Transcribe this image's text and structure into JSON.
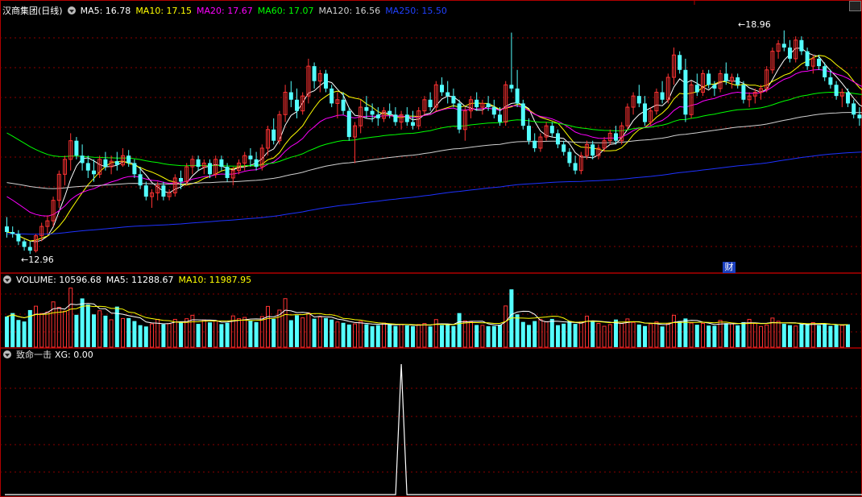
{
  "stock": {
    "name": "汉商集团(日线)"
  },
  "main_panel": {
    "ma": [
      {
        "label": "MA5: 16.78",
        "color": "#ffffff"
      },
      {
        "label": "MA10: 17.15",
        "color": "#ffff00"
      },
      {
        "label": "MA20: 17.67",
        "color": "#ff00ff"
      },
      {
        "label": "MA60: 17.07",
        "color": "#00ff00"
      },
      {
        "label": "MA120: 16.56",
        "color": "#d0d0d0"
      },
      {
        "label": "MA250: 15.50",
        "color": "#1e32ff"
      }
    ],
    "high_label": "18.96",
    "low_label": "12.96",
    "cai_badge": "财"
  },
  "volume_panel": {
    "labels": [
      {
        "label": "VOLUME: 10596.68",
        "color": "#ffffff"
      },
      {
        "label": "MA5: 11288.67",
        "color": "#ffffff"
      },
      {
        "label": "MA10: 11987.95",
        "color": "#ffff00"
      }
    ]
  },
  "indicator_panel": {
    "name": "致命一击",
    "xg_label": "XG: 0.00"
  },
  "colors": {
    "up": "#ff3232",
    "down": "#54ffff",
    "grid": "#8a0000",
    "border": "#b00000"
  },
  "chart_data": {
    "type": "candlestick",
    "price_range": [
      12.6,
      19.3
    ],
    "candles": [
      [
        13.7,
        13.95,
        13.4,
        13.55
      ],
      [
        13.55,
        13.7,
        13.4,
        13.5
      ],
      [
        13.5,
        13.6,
        13.2,
        13.3
      ],
      [
        13.3,
        13.35,
        13.05,
        13.15
      ],
      [
        13.15,
        13.3,
        12.96,
        13.05
      ],
      [
        13.05,
        13.5,
        13.0,
        13.45
      ],
      [
        13.45,
        13.8,
        13.3,
        13.7
      ],
      [
        13.7,
        14.0,
        13.5,
        13.85
      ],
      [
        13.85,
        14.5,
        13.7,
        14.4
      ],
      [
        14.4,
        15.2,
        14.2,
        15.1
      ],
      [
        15.1,
        15.6,
        14.8,
        15.5
      ],
      [
        15.5,
        16.2,
        15.2,
        16.0
      ],
      [
        16.0,
        16.1,
        15.5,
        15.6
      ],
      [
        15.6,
        15.9,
        15.2,
        15.4
      ],
      [
        15.4,
        15.6,
        15.0,
        15.2
      ],
      [
        15.2,
        15.5,
        14.9,
        15.1
      ],
      [
        15.1,
        15.6,
        15.0,
        15.5
      ],
      [
        15.5,
        15.7,
        15.2,
        15.3
      ],
      [
        15.3,
        15.6,
        15.1,
        15.45
      ],
      [
        15.45,
        15.7,
        15.2,
        15.35
      ],
      [
        15.35,
        15.8,
        15.3,
        15.6
      ],
      [
        15.6,
        15.75,
        15.3,
        15.4
      ],
      [
        15.4,
        15.5,
        15.0,
        15.1
      ],
      [
        15.1,
        15.3,
        14.7,
        14.8
      ],
      [
        14.8,
        14.9,
        14.4,
        14.5
      ],
      [
        14.5,
        14.7,
        14.2,
        14.6
      ],
      [
        14.6,
        14.9,
        14.4,
        14.8
      ],
      [
        14.8,
        14.9,
        14.4,
        14.5
      ],
      [
        14.5,
        14.7,
        14.4,
        14.6
      ],
      [
        14.6,
        15.1,
        14.5,
        15.0
      ],
      [
        15.0,
        15.2,
        14.7,
        14.9
      ],
      [
        14.9,
        15.4,
        14.8,
        15.3
      ],
      [
        15.3,
        15.6,
        15.1,
        15.5
      ],
      [
        15.5,
        15.6,
        15.2,
        15.3
      ],
      [
        15.3,
        15.5,
        15.1,
        15.4
      ],
      [
        15.4,
        15.5,
        15.0,
        15.1
      ],
      [
        15.1,
        15.6,
        15.0,
        15.5
      ],
      [
        15.5,
        15.6,
        15.2,
        15.3
      ],
      [
        15.3,
        15.4,
        14.9,
        15.0
      ],
      [
        15.0,
        15.3,
        14.8,
        15.2
      ],
      [
        15.2,
        15.5,
        15.1,
        15.4
      ],
      [
        15.4,
        15.7,
        15.2,
        15.6
      ],
      [
        15.6,
        15.8,
        15.3,
        15.5
      ],
      [
        15.5,
        15.7,
        15.2,
        15.3
      ],
      [
        15.3,
        15.9,
        15.2,
        15.8
      ],
      [
        15.8,
        16.4,
        15.6,
        16.3
      ],
      [
        16.3,
        16.6,
        15.9,
        16.0
      ],
      [
        16.0,
        16.8,
        15.9,
        16.7
      ],
      [
        16.7,
        17.5,
        16.5,
        17.3
      ],
      [
        17.3,
        17.6,
        16.9,
        17.1
      ],
      [
        17.1,
        17.4,
        16.6,
        16.8
      ],
      [
        16.8,
        17.3,
        16.7,
        17.2
      ],
      [
        17.2,
        18.2,
        17.0,
        18.0
      ],
      [
        18.0,
        18.1,
        17.4,
        17.6
      ],
      [
        17.6,
        17.9,
        17.3,
        17.8
      ],
      [
        17.8,
        17.9,
        17.3,
        17.4
      ],
      [
        17.4,
        17.5,
        16.9,
        17.0
      ],
      [
        17.0,
        17.3,
        16.6,
        17.1
      ],
      [
        17.1,
        17.3,
        16.7,
        16.8
      ],
      [
        16.8,
        16.9,
        16.0,
        16.1
      ],
      [
        16.1,
        16.5,
        15.4,
        16.4
      ],
      [
        16.4,
        17.1,
        16.2,
        16.9
      ],
      [
        16.9,
        17.2,
        16.6,
        16.8
      ],
      [
        16.8,
        17.0,
        16.5,
        16.7
      ],
      [
        16.7,
        16.9,
        16.4,
        16.6
      ],
      [
        16.6,
        16.9,
        16.5,
        16.8
      ],
      [
        16.8,
        17.0,
        16.6,
        16.7
      ],
      [
        16.7,
        16.9,
        16.4,
        16.5
      ],
      [
        16.5,
        16.8,
        16.3,
        16.7
      ],
      [
        16.7,
        16.9,
        16.4,
        16.5
      ],
      [
        16.5,
        16.8,
        16.3,
        16.4
      ],
      [
        16.4,
        16.9,
        16.3,
        16.8
      ],
      [
        16.8,
        17.2,
        16.7,
        17.1
      ],
      [
        17.1,
        17.3,
        16.8,
        16.9
      ],
      [
        16.9,
        17.6,
        16.8,
        17.5
      ],
      [
        17.5,
        17.7,
        17.2,
        17.3
      ],
      [
        17.3,
        17.6,
        17.0,
        17.2
      ],
      [
        17.2,
        17.4,
        16.9,
        17.0
      ],
      [
        17.0,
        17.1,
        16.2,
        16.3
      ],
      [
        16.3,
        16.9,
        16.0,
        16.8
      ],
      [
        16.8,
        17.2,
        16.6,
        17.1
      ],
      [
        17.1,
        17.3,
        16.8,
        16.9
      ],
      [
        16.9,
        17.1,
        16.7,
        17.0
      ],
      [
        17.0,
        17.2,
        16.8,
        16.9
      ],
      [
        16.9,
        17.1,
        16.6,
        16.7
      ],
      [
        16.7,
        16.9,
        16.4,
        16.5
      ],
      [
        16.5,
        17.6,
        16.4,
        17.5
      ],
      [
        17.5,
        18.9,
        17.3,
        17.4
      ],
      [
        17.4,
        17.9,
        16.9,
        17.0
      ],
      [
        17.0,
        17.1,
        16.3,
        16.4
      ],
      [
        16.4,
        16.6,
        15.9,
        16.0
      ],
      [
        16.0,
        16.2,
        15.7,
        15.8
      ],
      [
        15.8,
        16.2,
        15.7,
        16.1
      ],
      [
        16.1,
        16.5,
        16.0,
        16.4
      ],
      [
        16.4,
        16.5,
        16.1,
        16.2
      ],
      [
        16.2,
        16.3,
        15.8,
        15.9
      ],
      [
        15.9,
        16.0,
        15.6,
        15.7
      ],
      [
        15.7,
        15.8,
        15.3,
        15.4
      ],
      [
        15.4,
        15.6,
        15.1,
        15.2
      ],
      [
        15.2,
        15.7,
        15.1,
        15.6
      ],
      [
        15.6,
        16.0,
        15.5,
        15.9
      ],
      [
        15.9,
        16.0,
        15.5,
        15.6
      ],
      [
        15.6,
        15.9,
        15.5,
        15.8
      ],
      [
        15.8,
        16.1,
        15.7,
        16.0
      ],
      [
        16.0,
        16.3,
        15.9,
        16.2
      ],
      [
        16.2,
        16.4,
        15.9,
        16.0
      ],
      [
        16.0,
        16.5,
        15.9,
        16.4
      ],
      [
        16.4,
        17.0,
        16.3,
        16.9
      ],
      [
        16.9,
        17.3,
        16.7,
        17.2
      ],
      [
        17.2,
        17.5,
        16.9,
        17.0
      ],
      [
        17.0,
        17.2,
        16.4,
        16.5
      ],
      [
        16.5,
        16.9,
        16.4,
        16.8
      ],
      [
        16.8,
        17.4,
        16.7,
        17.3
      ],
      [
        17.3,
        17.6,
        17.0,
        17.1
      ],
      [
        17.1,
        17.8,
        17.0,
        17.7
      ],
      [
        17.7,
        18.5,
        17.5,
        18.3
      ],
      [
        18.3,
        18.4,
        17.8,
        17.9
      ],
      [
        17.9,
        18.2,
        16.5,
        16.7
      ],
      [
        16.7,
        17.6,
        16.6,
        17.5
      ],
      [
        17.5,
        17.8,
        17.2,
        17.3
      ],
      [
        17.3,
        17.9,
        17.2,
        17.8
      ],
      [
        17.8,
        17.9,
        17.4,
        17.5
      ],
      [
        17.5,
        17.6,
        17.2,
        17.4
      ],
      [
        17.4,
        17.9,
        17.3,
        17.8
      ],
      [
        17.8,
        18.1,
        17.5,
        17.6
      ],
      [
        17.6,
        17.8,
        17.4,
        17.7
      ],
      [
        17.7,
        17.8,
        17.4,
        17.5
      ],
      [
        17.5,
        17.6,
        17.0,
        17.1
      ],
      [
        17.1,
        17.3,
        16.9,
        17.2
      ],
      [
        17.2,
        17.4,
        17.0,
        17.3
      ],
      [
        17.3,
        17.5,
        17.1,
        17.4
      ],
      [
        17.4,
        18.0,
        17.3,
        17.9
      ],
      [
        17.9,
        18.5,
        17.8,
        18.4
      ],
      [
        18.4,
        18.7,
        18.2,
        18.6
      ],
      [
        18.6,
        18.96,
        18.4,
        18.5
      ],
      [
        18.5,
        18.7,
        18.1,
        18.2
      ],
      [
        18.2,
        18.8,
        18.1,
        18.7
      ],
      [
        18.7,
        18.8,
        18.3,
        18.4
      ],
      [
        18.4,
        18.5,
        17.9,
        18.0
      ],
      [
        18.0,
        18.3,
        17.8,
        18.2
      ],
      [
        18.2,
        18.3,
        17.9,
        18.0
      ],
      [
        18.0,
        18.1,
        17.6,
        17.7
      ],
      [
        17.7,
        17.9,
        17.4,
        17.5
      ],
      [
        17.5,
        17.6,
        17.1,
        17.2
      ],
      [
        17.2,
        17.4,
        16.9,
        17.3
      ],
      [
        17.3,
        17.4,
        16.9,
        17.0
      ],
      [
        17.0,
        17.1,
        16.6,
        16.7
      ],
      [
        16.7,
        16.9,
        16.4,
        16.6
      ],
      [
        16.6,
        16.9,
        16.4,
        16.8
      ],
      [
        16.8,
        16.9,
        16.3,
        16.4
      ]
    ],
    "volume": [
      14200,
      15800,
      12600,
      11900,
      17200,
      19000,
      15600,
      16300,
      21000,
      18500,
      16700,
      27400,
      15000,
      22600,
      19800,
      15200,
      16900,
      14600,
      12700,
      18800,
      13300,
      13500,
      12100,
      10200,
      9600,
      10800,
      12900,
      10600,
      10900,
      12900,
      11600,
      13200,
      14800,
      10800,
      12600,
      11500,
      12300,
      10700,
      11300,
      14500,
      13200,
      13800,
      12400,
      11600,
      14200,
      18900,
      13100,
      17200,
      22500,
      12500,
      14800,
      13600,
      15900,
      13200,
      14000,
      13500,
      12800,
      11700,
      11300,
      10500,
      10800,
      11900,
      10600,
      9700,
      10200,
      11200,
      10800,
      9800,
      10600,
      10100,
      9700,
      10500,
      11000,
      9600,
      12800,
      10200,
      10400,
      9800,
      15800,
      12200,
      11800,
      10300,
      10100,
      9700,
      9800,
      10400,
      19100,
      26800,
      15200,
      11700,
      10300,
      12100,
      12800,
      11800,
      13100,
      10200,
      10900,
      12100,
      10800,
      11700,
      14400,
      12200,
      11000,
      9700,
      10500,
      12800,
      11000,
      13100,
      11500,
      10500,
      9800,
      10800,
      11700,
      9600,
      10900,
      14800,
      12100,
      13300,
      11200,
      10400,
      11000,
      10000,
      9900,
      12400,
      11100,
      10800,
      10100,
      11600,
      12900,
      11000,
      9600,
      10300,
      13500,
      12000,
      10800,
      10200,
      9800,
      10600,
      10900,
      11400,
      10200,
      10800,
      9900,
      10300,
      10100,
      10596.68
    ],
    "xg_signals": [
      68,
      149
    ],
    "xg_range": [
      0,
      1
    ]
  }
}
